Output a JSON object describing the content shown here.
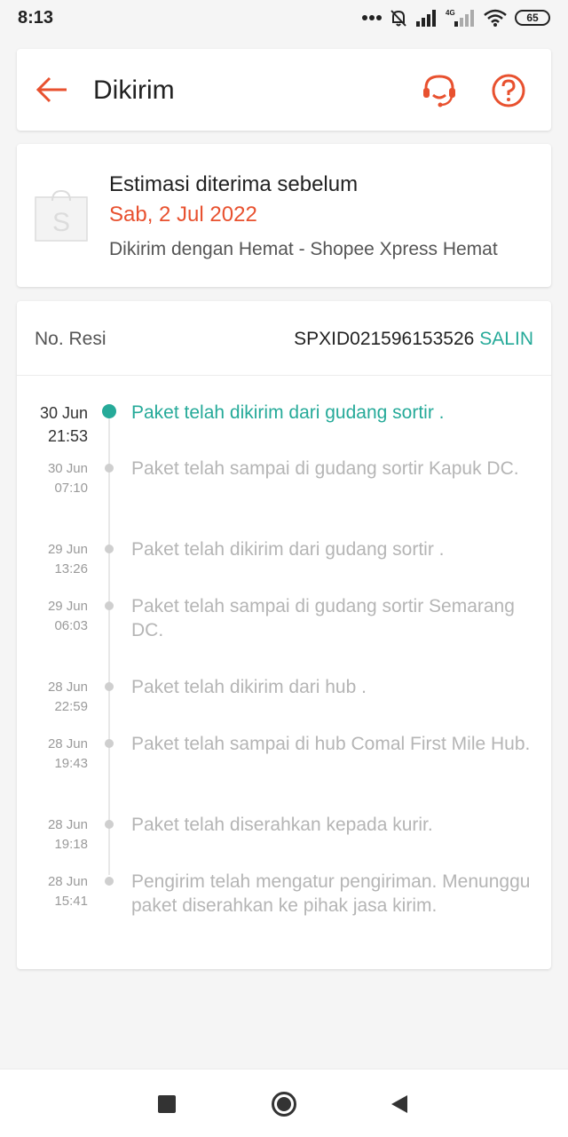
{
  "status_bar": {
    "time": "8:13",
    "network": "4G",
    "battery": "65"
  },
  "header": {
    "title": "Dikirim",
    "back_icon": "arrow-left-icon",
    "support_icon": "headset-icon",
    "help_icon": "question-circle-icon",
    "accent_color": "#e8512f"
  },
  "estimation": {
    "title": "Estimasi diterima sebelum",
    "date": "Sab, 2 Jul 2022",
    "service": "Dikirim dengan Hemat - Shopee Xpress Hemat",
    "logo_icon": "shopping-bag-icon"
  },
  "tracking": {
    "resi_label": "No. Resi",
    "resi_number": "SPXID021596153526",
    "copy_label": "SALIN",
    "active_color": "#26aa99",
    "events": [
      {
        "date": "30 Jun",
        "time": "21:53",
        "text": "Paket telah dikirim dari gudang sortir ."
      },
      {
        "date": "30 Jun",
        "time": "07:10",
        "text": "Paket telah sampai di gudang sortir Kapuk DC."
      },
      {
        "date": "29 Jun",
        "time": "13:26",
        "text": "Paket telah dikirim dari gudang sortir ."
      },
      {
        "date": "29 Jun",
        "time": "06:03",
        "text": "Paket telah sampai di gudang sortir Semarang DC."
      },
      {
        "date": "28 Jun",
        "time": "22:59",
        "text": "Paket telah dikirim dari hub ."
      },
      {
        "date": "28 Jun",
        "time": "19:43",
        "text": "Paket telah sampai di hub Comal First Mile Hub."
      },
      {
        "date": "28 Jun",
        "time": "19:18",
        "text": "Paket telah diserahkan kepada kurir."
      },
      {
        "date": "28 Jun",
        "time": "15:41",
        "text": "Pengirim telah mengatur pengiriman. Menunggu paket diserahkan ke pihak jasa kirim."
      }
    ]
  },
  "nav_bar": {
    "recents_icon": "square-icon",
    "home_icon": "circle-home-icon",
    "back_icon": "triangle-back-icon"
  }
}
